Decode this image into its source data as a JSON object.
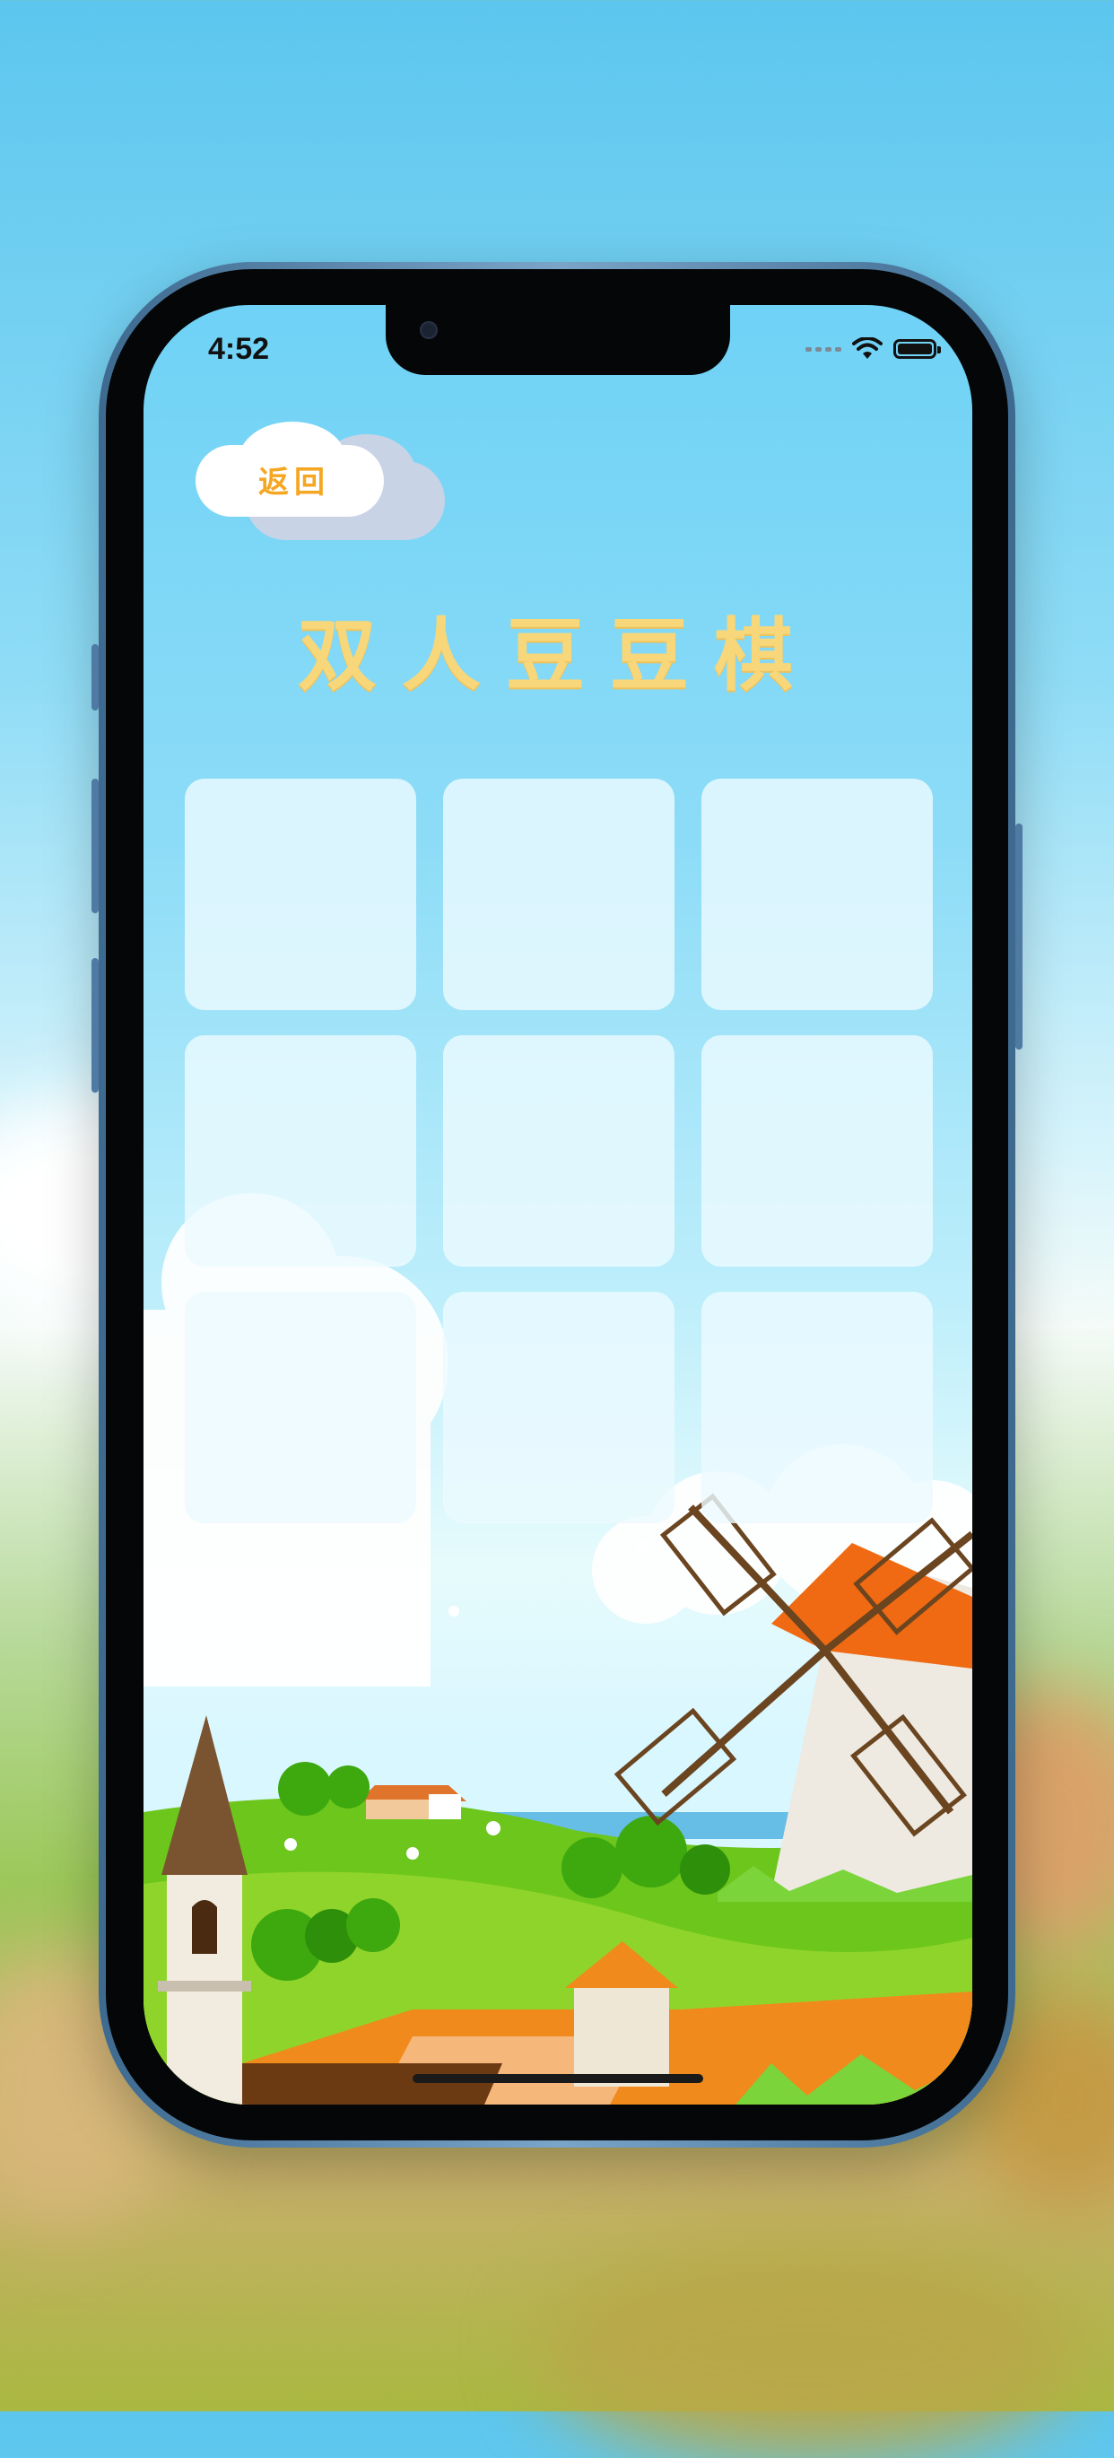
{
  "status_bar": {
    "time": "4:52"
  },
  "header": {
    "back_label": "返回",
    "title": "双人豆豆棋"
  },
  "board": {
    "cells": [
      "",
      "",
      "",
      "",
      "",
      "",
      "",
      "",
      ""
    ]
  },
  "colors": {
    "title": "#f7d77a",
    "back_text": "#f5a623",
    "cell": "#ecfaff"
  },
  "icons": [
    "wifi-icon",
    "battery-icon",
    "cellular-icon",
    "cloud-icon",
    "windmill-icon"
  ]
}
